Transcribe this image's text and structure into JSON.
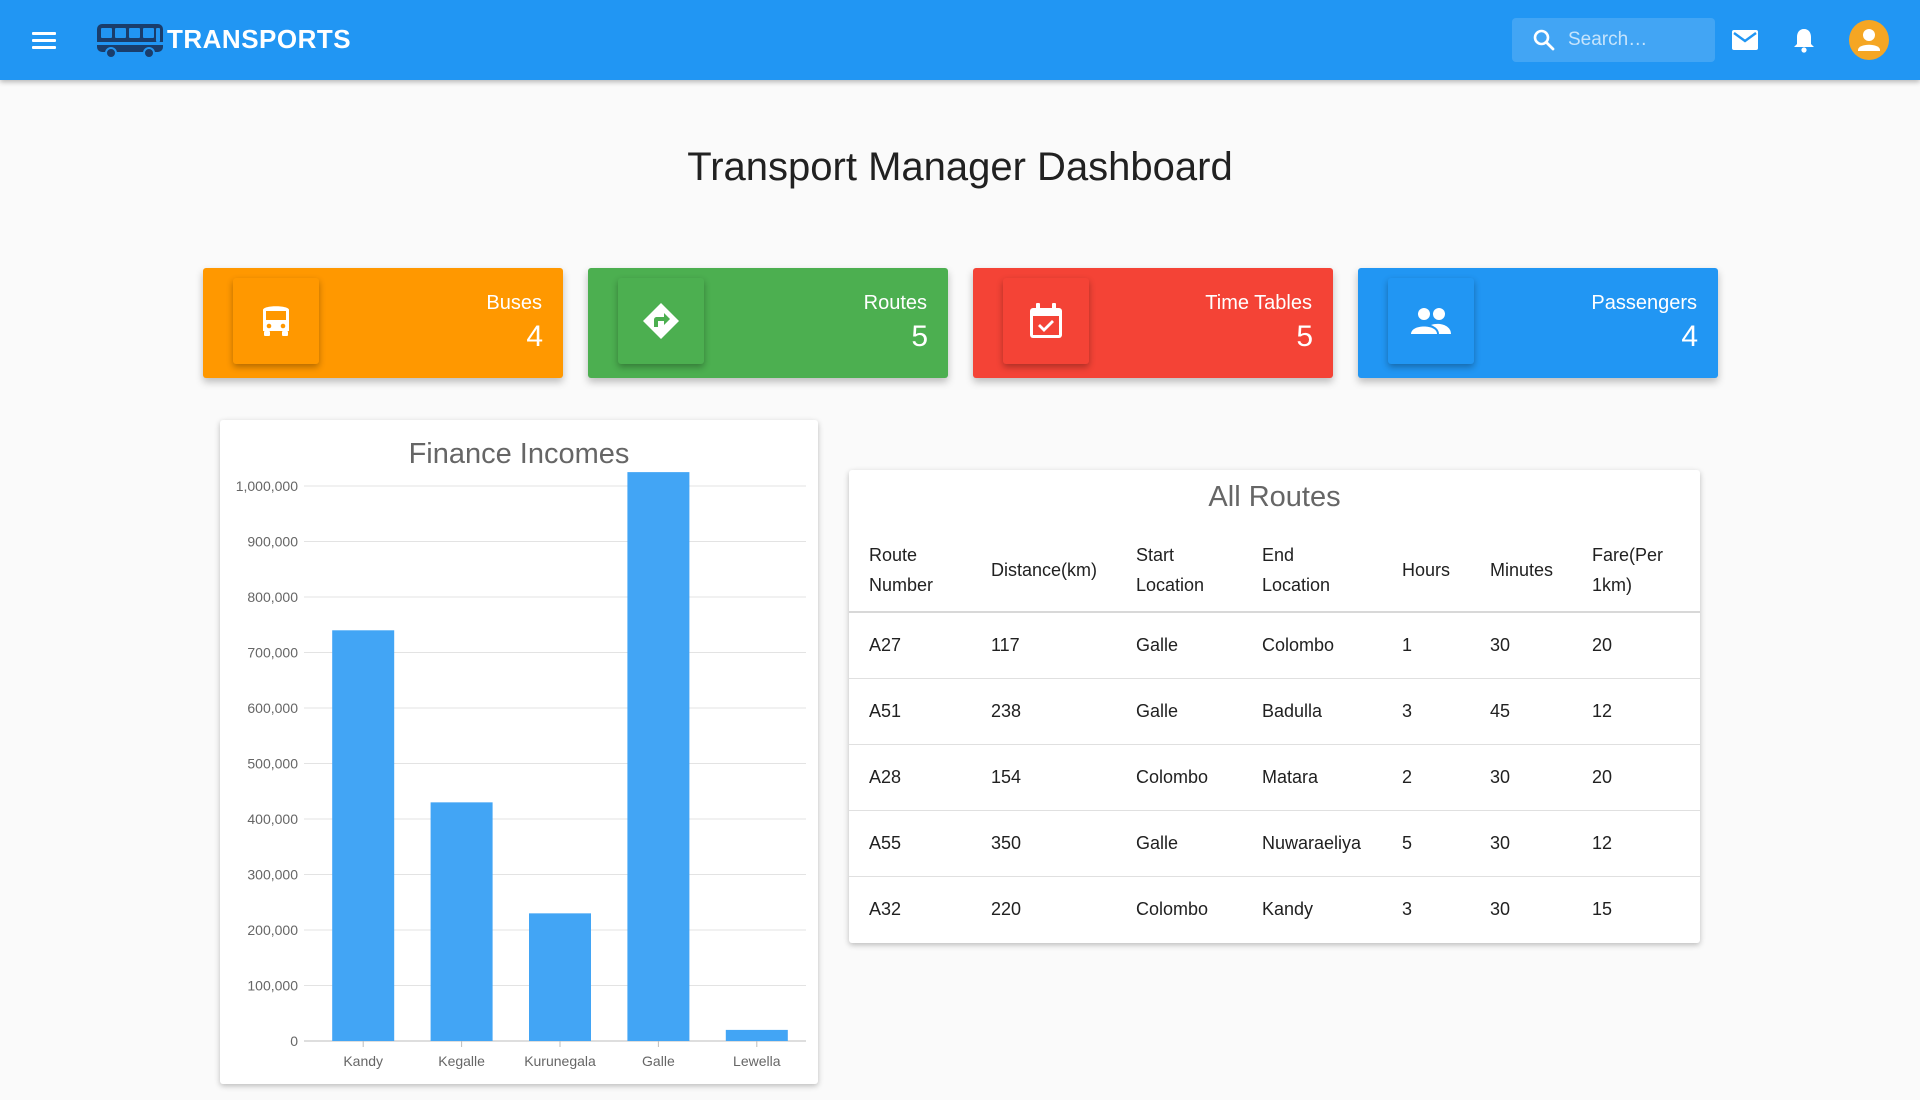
{
  "app": {
    "title": "TRANSPORTS",
    "search_placeholder": "Search…"
  },
  "page": {
    "title": "Transport Manager Dashboard"
  },
  "stats": [
    {
      "label": "Buses",
      "value": "4",
      "color": "#ff9800",
      "icon": "bus-icon"
    },
    {
      "label": "Routes",
      "value": "5",
      "color": "#4caf50",
      "icon": "directions-icon"
    },
    {
      "label": "Time Tables",
      "value": "5",
      "color": "#f44336",
      "icon": "calendar-check-icon"
    },
    {
      "label": "Passengers",
      "value": "4",
      "color": "#2196f3",
      "icon": "people-icon"
    }
  ],
  "chart_data": {
    "type": "bar",
    "title": "Finance Incomes",
    "categories": [
      "Kandy",
      "Kegalle",
      "Kurunegala",
      "Galle",
      "Lewella"
    ],
    "values": [
      740000,
      430000,
      230000,
      1025000,
      20000
    ],
    "ylim": [
      0,
      1000000
    ],
    "yticks": [
      "0",
      "100,000",
      "200,000",
      "300,000",
      "400,000",
      "500,000",
      "600,000",
      "700,000",
      "800,000",
      "900,000",
      "1,000,000"
    ],
    "grid": true,
    "bar_color": "#42a5f5"
  },
  "routes": {
    "title": "All Routes",
    "headers": [
      {
        "line1": "Route",
        "line2": "Number"
      },
      {
        "line1": "Distance(km)",
        "line2": ""
      },
      {
        "line1": "Start",
        "line2": "Location"
      },
      {
        "line1": "End",
        "line2": "Location"
      },
      {
        "line1": "Hours",
        "line2": ""
      },
      {
        "line1": "Minutes",
        "line2": ""
      },
      {
        "line1": "Fare(Per",
        "line2": "1km)"
      }
    ],
    "rows": [
      [
        "A27",
        "117",
        "Galle",
        "Colombo",
        "1",
        "30",
        "20"
      ],
      [
        "A51",
        "238",
        "Galle",
        "Badulla",
        "3",
        "45",
        "12"
      ],
      [
        "A28",
        "154",
        "Colombo",
        "Matara",
        "2",
        "30",
        "20"
      ],
      [
        "A55",
        "350",
        "Galle",
        "Nuwaraeliya",
        "5",
        "30",
        "12"
      ],
      [
        "A32",
        "220",
        "Colombo",
        "Kandy",
        "3",
        "30",
        "15"
      ]
    ]
  }
}
